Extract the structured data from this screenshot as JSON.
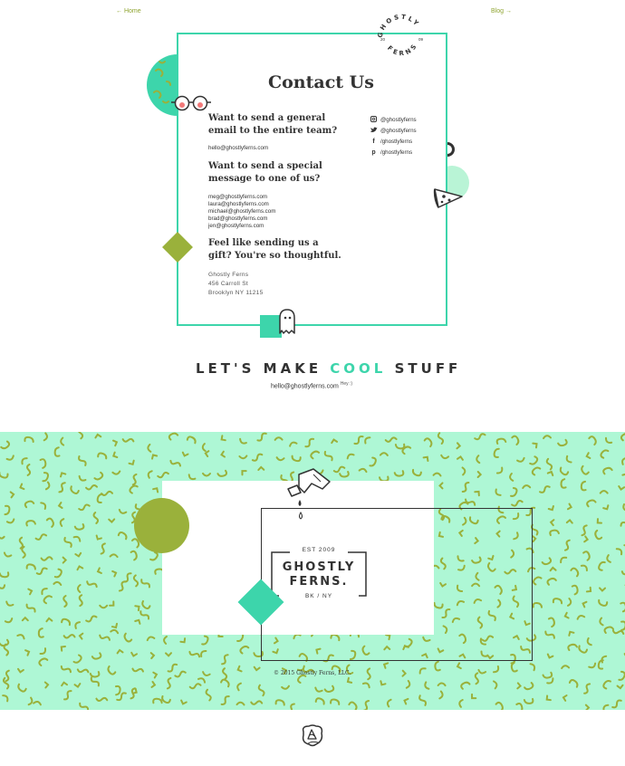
{
  "nav": {
    "home_label": "← Home",
    "blog_label": "Blog →"
  },
  "badge": {
    "top_text": "GHOSTLY",
    "bottom_text": "FERNS",
    "year_left": "20",
    "year_right": "09"
  },
  "contact": {
    "title": "Contact Us",
    "q1": "Want to send a general email to the entire team?",
    "team_email": "hello@ghostlyferns.com",
    "q2": "Want to send a special message to one of us?",
    "personal_emails": [
      "meg@ghostlyferns.com",
      "laura@ghostlyferns.com",
      "michael@ghostlyferns.com",
      "brad@ghostlyferns.com",
      "jen@ghostlyferns.com"
    ],
    "q3": "Feel like sending us a gift? You're so thoughtful.",
    "address": [
      "Ghostly Ferns",
      "456 Carroll St",
      "Brooklyn NY 11215"
    ]
  },
  "social": [
    {
      "icon": "instagram-icon",
      "label": "@ghostlyferns"
    },
    {
      "icon": "twitter-icon",
      "label": "@ghostlyferns"
    },
    {
      "icon": "facebook-icon",
      "label": "/ghostlyferns"
    },
    {
      "icon": "pinterest-icon",
      "label": "/ghostlyferns"
    }
  ],
  "tagline": {
    "before": "LET'S MAKE ",
    "highlight": "COOL",
    "after": " STUFF"
  },
  "hello": {
    "email": "hello@ghostlyferns.com",
    "note": "Hey :)"
  },
  "logo": {
    "est": "EST 2009",
    "line1": "GHOSTLY",
    "line2": "FERNS.",
    "location": "BK / NY"
  },
  "footer": {
    "copyright": "© 2015 Ghostly Ferns, LLC."
  },
  "colors": {
    "teal": "#3dd5ab",
    "olive": "#9ab13b",
    "mint": "#aef7d5",
    "dark": "#333333"
  }
}
